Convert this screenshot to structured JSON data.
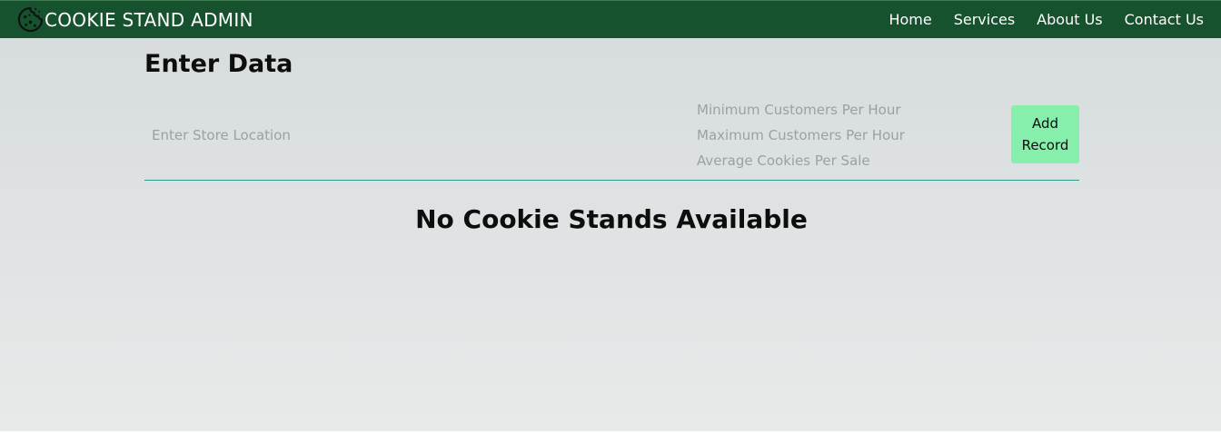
{
  "header": {
    "title": "COOKIE STAND ADMIN",
    "logo_icon": "cookie-icon",
    "background_color": "#15522d",
    "nav": [
      {
        "label": "Home"
      },
      {
        "label": "Services"
      },
      {
        "label": "About Us"
      },
      {
        "label": "Contact Us"
      }
    ]
  },
  "form": {
    "heading": "Enter Data",
    "location_placeholder": "Enter Store Location",
    "min_customers_placeholder": "Minimum Customers Per Hour",
    "max_customers_placeholder": "Maximum Customers Per Hour",
    "avg_cookies_placeholder": "Average Cookies Per Sale",
    "submit_label": "Add Record",
    "submit_color": "#86efac"
  },
  "report": {
    "empty_message": "No Cookie Stands Available"
  }
}
